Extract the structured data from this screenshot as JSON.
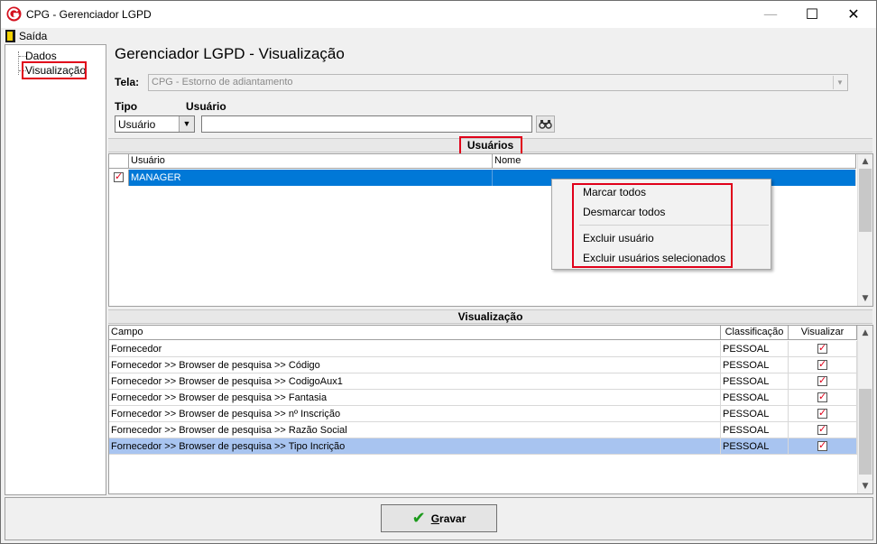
{
  "window": {
    "title": "CPG - Gerenciador LGPD",
    "minimize": "—",
    "maximize": "☐",
    "close": "✕"
  },
  "menu": {
    "exit_label": "Saída",
    "exit_icon": "door-exit-icon"
  },
  "tree": {
    "items": [
      "Dados",
      "Visualização"
    ]
  },
  "page_title": "Gerenciador LGPD - Visualização",
  "tela": {
    "label": "Tela:",
    "value": "CPG - Estorno de adiantamento"
  },
  "filter": {
    "tipo_label": "Tipo",
    "usuario_label": "Usuário",
    "tipo_value": "Usuário",
    "usuario_value": ""
  },
  "users_section": {
    "header": "Usuários",
    "columns": [
      "Usuário",
      "Nome"
    ],
    "rows": [
      {
        "checked": true,
        "usuario": "MANAGER",
        "nome": ""
      }
    ]
  },
  "context_menu": {
    "items": [
      "Marcar todos",
      "Desmarcar todos",
      "Excluir usuário",
      "Excluir usuários selecionados"
    ]
  },
  "view_section": {
    "header": "Visualização",
    "columns": [
      "Campo",
      "Classificação",
      "Visualizar"
    ],
    "rows": [
      {
        "campo": "Fornecedor",
        "classificacao": "PESSOAL",
        "visualizar": true
      },
      {
        "campo": "Fornecedor >> Browser de pesquisa >> Código",
        "classificacao": "PESSOAL",
        "visualizar": true
      },
      {
        "campo": "Fornecedor >> Browser de pesquisa >> CodigoAux1",
        "classificacao": "PESSOAL",
        "visualizar": true
      },
      {
        "campo": "Fornecedor >> Browser de pesquisa >> Fantasia",
        "classificacao": "PESSOAL",
        "visualizar": true
      },
      {
        "campo": "Fornecedor >> Browser de pesquisa >> nº Inscrição",
        "classificacao": "PESSOAL",
        "visualizar": true
      },
      {
        "campo": "Fornecedor >> Browser de pesquisa >> Razão Social",
        "classificacao": "PESSOAL",
        "visualizar": true
      },
      {
        "campo": "Fornecedor >> Browser de pesquisa >> Tipo Incrição",
        "classificacao": "PESSOAL",
        "visualizar": true
      }
    ]
  },
  "footer": {
    "save_prefix": "",
    "save_hotkey": "G",
    "save_rest": "ravar"
  },
  "colors": {
    "selection": "#0078d7",
    "row_highlight": "#a8c4f0",
    "highlight_box": "#e0001a",
    "check_red": "#e0001a",
    "save_check": "#1b9a1b"
  }
}
